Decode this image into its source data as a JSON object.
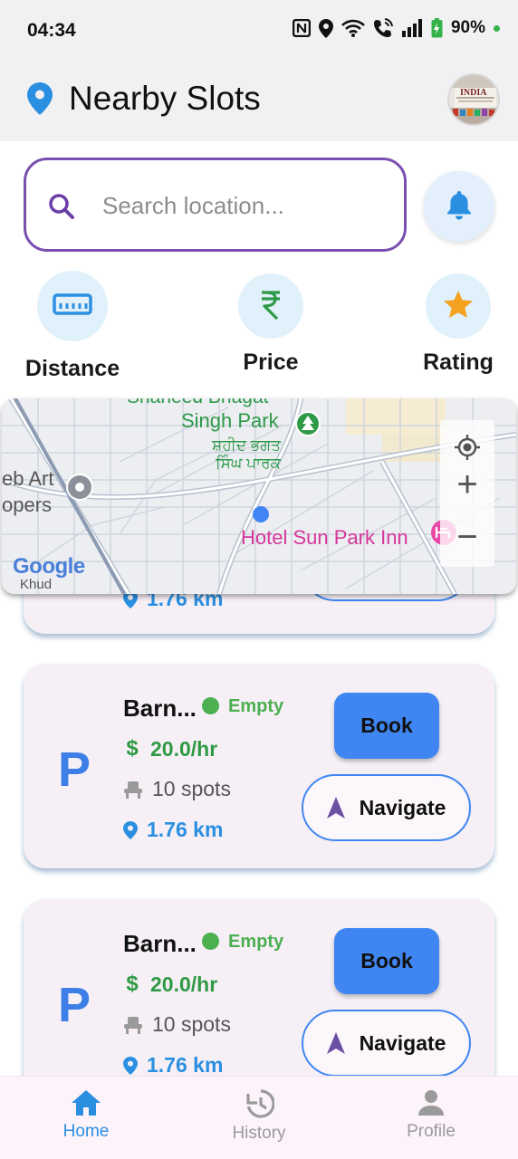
{
  "status_bar": {
    "time": "04:34",
    "battery": "90%",
    "icons": [
      "nfc-icon",
      "location-icon",
      "wifi-icon",
      "wifi-call-icon",
      "signal-icon",
      "battery-charging-icon"
    ]
  },
  "header": {
    "title": "Nearby Slots",
    "icon": "location-pin-icon",
    "avatar_caption": "INDIA"
  },
  "search": {
    "placeholder": "Search location...",
    "value": ""
  },
  "filters": [
    {
      "label": "Distance",
      "icon": "ruler-icon"
    },
    {
      "label": "Price",
      "icon": "rupee-icon"
    },
    {
      "label": "Rating",
      "icon": "star-icon"
    }
  ],
  "map": {
    "labels": {
      "park": "Singh Park",
      "park_local_1": "ਸ਼ਹੀਦ ਭਗਤ",
      "park_local_2": "ਸਿੰਘ ਪਾਰਕ",
      "park_top_clipped": "Shaheed Bhagat",
      "hotel": "Hotel Sun Park Inn",
      "left_1": "eb Art",
      "left_2": "opers",
      "bottom_left": "Khud",
      "google": "Google"
    },
    "zoom_in": "+",
    "zoom_out": "−"
  },
  "partial_card": {
    "distance": "1.76 km"
  },
  "cards": [
    {
      "name": "Barn...",
      "status": "Empty",
      "price": "20.0/hr",
      "currency": "$",
      "spots": "10 spots",
      "distance": "1.76 km",
      "book_label": "Book",
      "navigate_label": "Navigate",
      "logo": "P"
    },
    {
      "name": "Barn...",
      "status": "Empty",
      "price": "20.0/hr",
      "currency": "$",
      "spots": "10 spots",
      "distance": "1.76 km",
      "book_label": "Book",
      "navigate_label": "Navigate",
      "logo": "P"
    }
  ],
  "bottom_nav": [
    {
      "label": "Home",
      "icon": "home-icon",
      "active": true
    },
    {
      "label": "History",
      "icon": "history-icon",
      "active": false
    },
    {
      "label": "Profile",
      "icon": "person-icon",
      "active": false
    }
  ],
  "colors": {
    "accent_blue": "#3f86f2",
    "brand_purple": "#7a4fb0",
    "status_green": "#4caf50",
    "nav_active": "#2a8fe0",
    "nav_inactive": "#9a9a9a"
  }
}
